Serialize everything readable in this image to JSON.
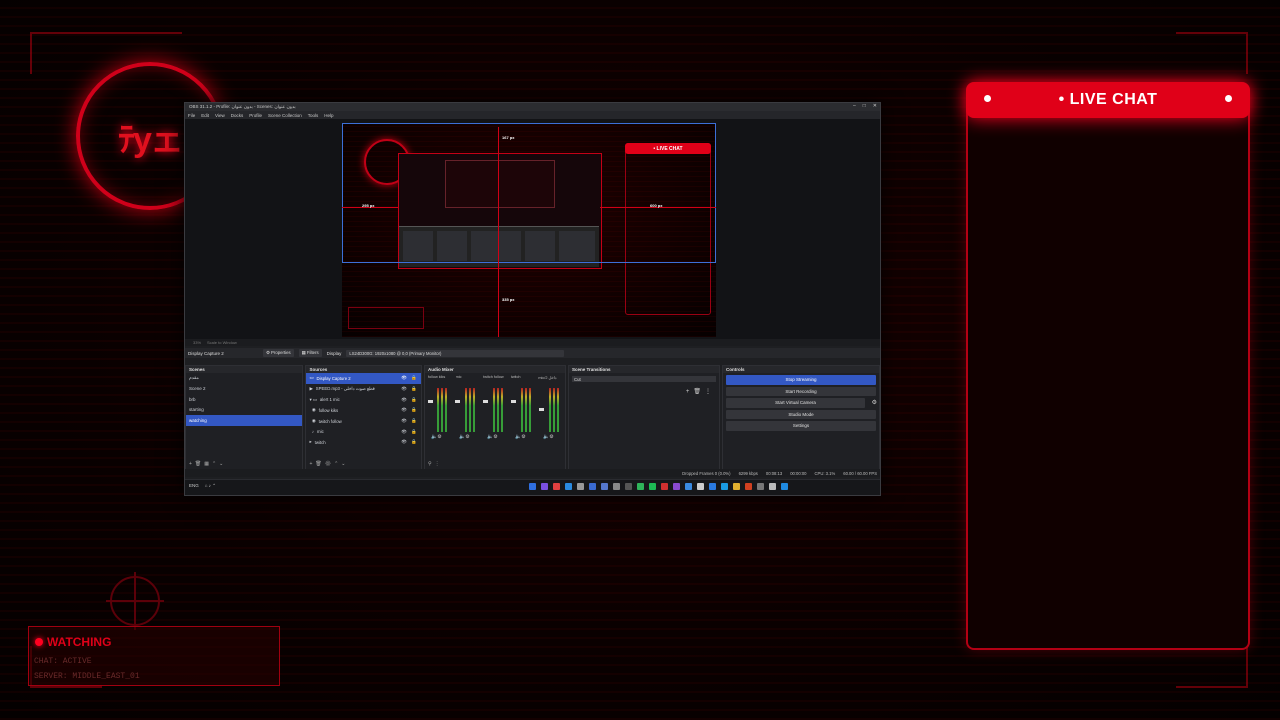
{
  "overlay": {
    "logo_text": "ﾃуェ",
    "live_chat_title": "LIVE CHAT",
    "status_label": "WATCHING",
    "status_lines": [
      "CHAT: ACTIVE",
      "SERVER: MIDDLE_EAST_01"
    ],
    "colors": {
      "accent": "#e00018",
      "background": "#070000"
    }
  },
  "obs": {
    "title": "OBS 31.1.2 - Profile: بدون عنوان - Scenes: بدون عنوان",
    "menu": [
      "File",
      "Edit",
      "View",
      "Docks",
      "Profile",
      "Scene Collection",
      "Tools",
      "Help"
    ],
    "preview": {
      "guide_top": "167 px",
      "guide_left": "295 px",
      "guide_right": "600 px",
      "guide_bottom": "335 px",
      "live_chat_mini": "• LIVE CHAT"
    },
    "preview_toolbar": [
      "33%",
      "Scale to Window"
    ],
    "source_bar": {
      "selected_source": "Display Capture 2",
      "properties": "Properties",
      "filters": "Filters",
      "display_label": "Display",
      "display_value": "LS24D300G: 1920x1080 @ 0,0 (Primary Monitor)"
    },
    "scenes": {
      "title": "Scenes",
      "items": [
        "مقدم",
        "Scene 2",
        "brb",
        "starting",
        "watching"
      ],
      "selected_index": 4
    },
    "sources": {
      "title": "Sources",
      "items": [
        "Display Capture 2",
        "SPEED.mp3 - قطع صوت داخلی",
        "alert 1 mic",
        "follow kiks",
        "twitch follow",
        "mic",
        "twitch"
      ]
    },
    "mixer": {
      "title": "Audio Mixer",
      "channels": [
        "follow kiks",
        "mic",
        "twitch follow",
        "twitch",
        "mic/2 داخل"
      ]
    },
    "transitions": {
      "title": "Scene Transitions",
      "value": "Cut"
    },
    "controls": {
      "title": "Controls",
      "buttons": [
        "Stop Streaming",
        "Start Recording",
        "Start Virtual Camera",
        "Studio Mode",
        "Settings"
      ]
    },
    "statusbar": [
      "Dropped Frames 0 (0.0%)",
      "6299 kbps",
      "00:08:13",
      "00:00:00",
      "CPU: 3.1%",
      "60.00 / 60.00 FPS"
    ],
    "taskbar_left": [
      "ENG"
    ]
  }
}
